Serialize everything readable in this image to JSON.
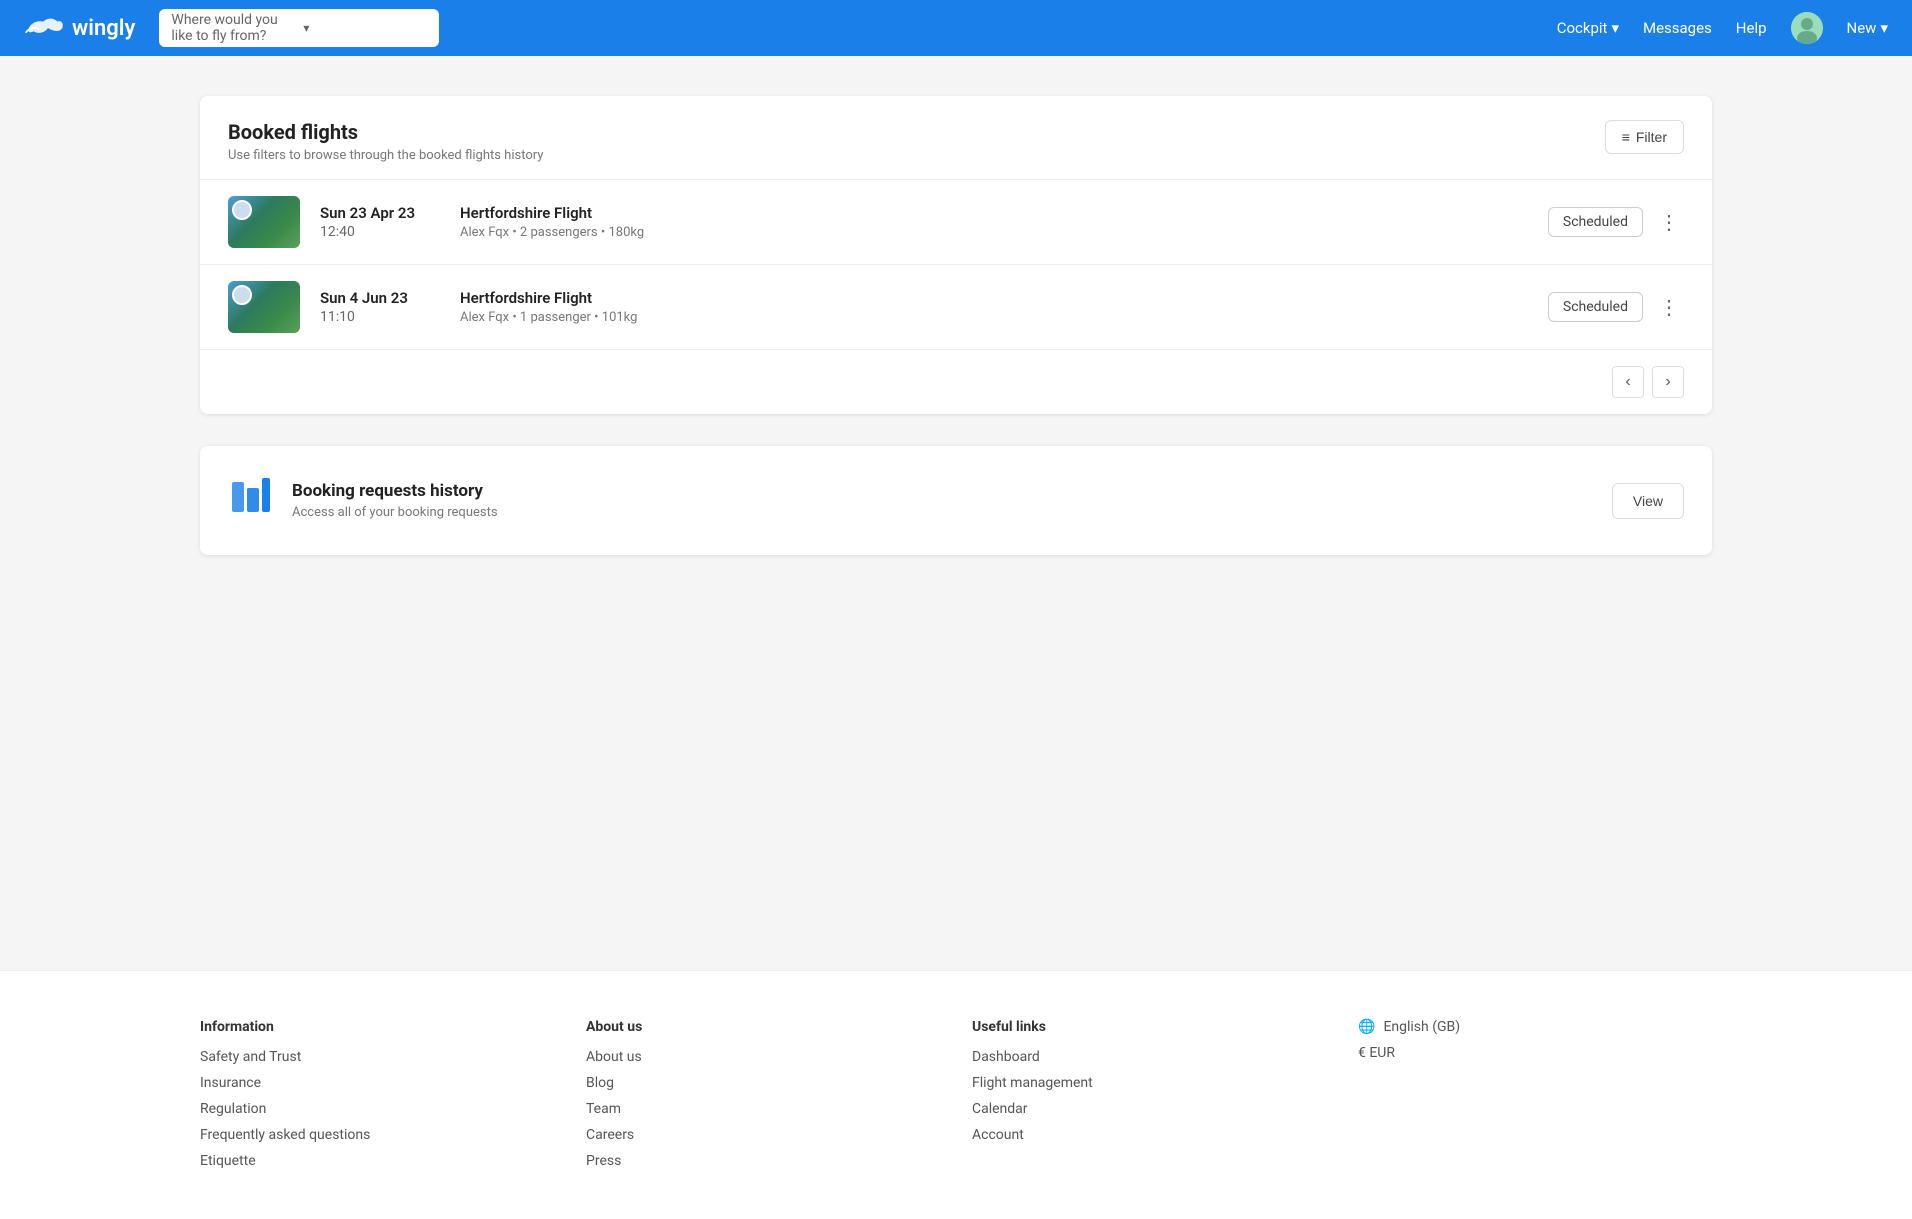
{
  "header": {
    "logo_text": "wingly",
    "search_placeholder": "Where would you like to fly from?",
    "nav": {
      "cockpit_label": "Cockpit",
      "messages_label": "Messages",
      "help_label": "Help",
      "new_label": "New"
    }
  },
  "booked_flights": {
    "title": "Booked flights",
    "subtitle": "Use filters to browse through the booked flights history",
    "filter_label": "Filter",
    "flights": [
      {
        "date": "Sun 23 Apr 23",
        "time": "12:40",
        "name": "Hertfordshire Flight",
        "details": "Alex Fqx • 2 passengers • 180kg",
        "status": "Scheduled"
      },
      {
        "date": "Sun 4 Jun 23",
        "time": "11:10",
        "name": "Hertfordshire Flight",
        "details": "Alex Fqx • 1 passenger • 101kg",
        "status": "Scheduled"
      }
    ]
  },
  "booking_requests": {
    "title": "Booking requests history",
    "description": "Access all of your booking requests",
    "view_label": "View"
  },
  "footer": {
    "information": {
      "title": "Information",
      "links": [
        "Safety and Trust",
        "Insurance",
        "Regulation",
        "Frequently asked questions",
        "Etiquette"
      ]
    },
    "about_us": {
      "title": "About us",
      "links": [
        "About us",
        "Blog",
        "Team",
        "Careers",
        "Press"
      ]
    },
    "useful_links": {
      "title": "Useful links",
      "links": [
        "Dashboard",
        "Flight management",
        "Calendar",
        "Account"
      ]
    },
    "settings": {
      "language": "English (GB)",
      "currency": "€ EUR"
    }
  }
}
